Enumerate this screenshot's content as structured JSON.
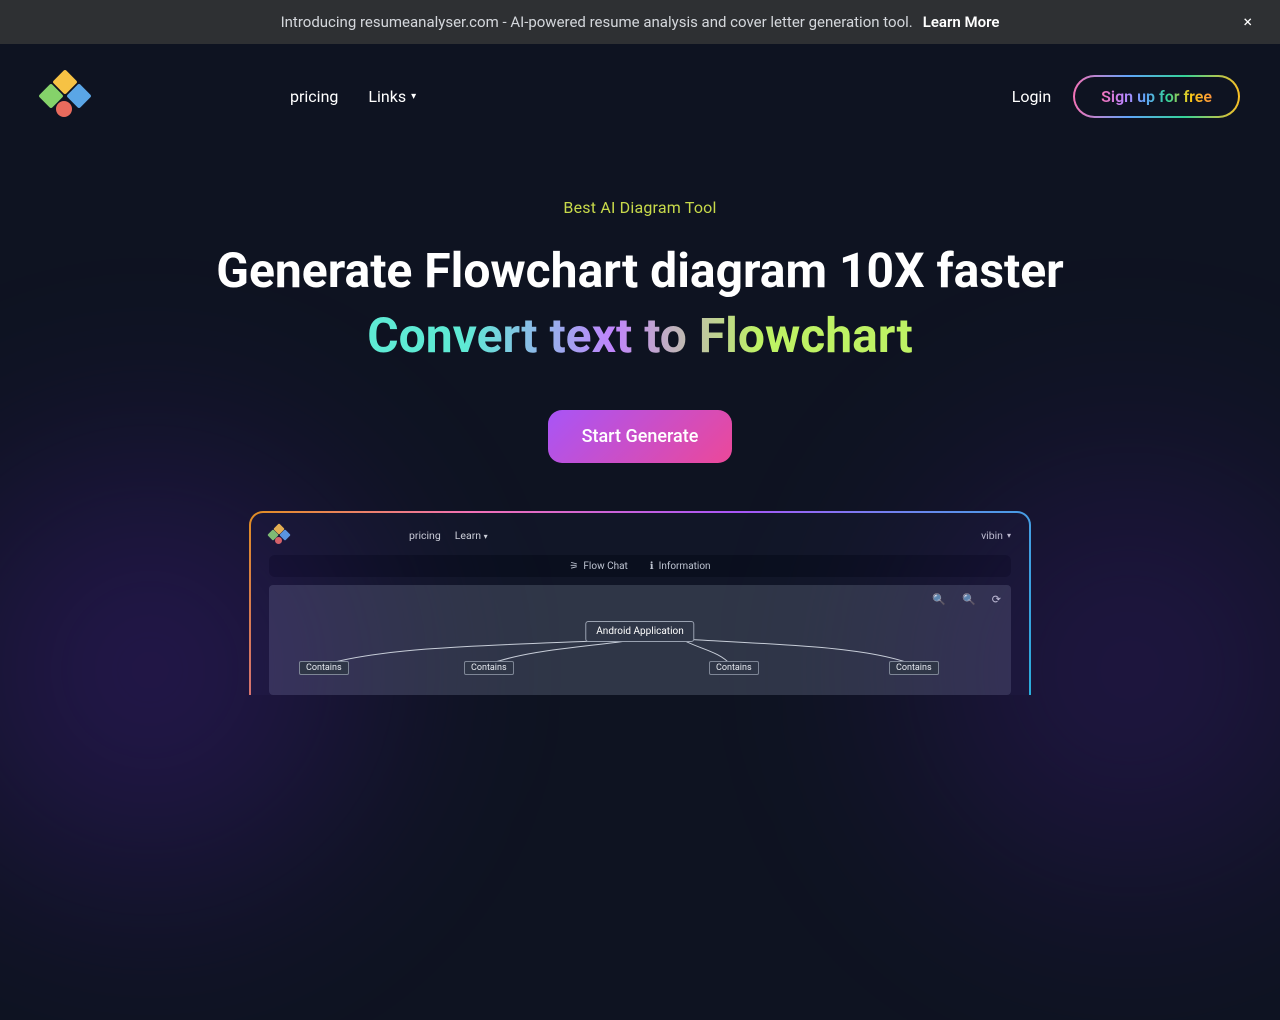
{
  "banner": {
    "text": "Introducing resumeanalyser.com - AI-powered resume analysis and cover letter generation tool.",
    "cta": "Learn More",
    "close": "×"
  },
  "nav": {
    "pricing": "pricing",
    "links": "Links"
  },
  "auth": {
    "login": "Login",
    "signup": "Sign up for free"
  },
  "hero": {
    "eyebrow": "Best AI Diagram Tool",
    "headline": "Generate Flowchart diagram 10X faster",
    "subhead": "Convert text to Flowchart",
    "cta": "Start Generate"
  },
  "demo": {
    "nav_pricing": "pricing",
    "nav_learn": "Learn",
    "user": "vibin",
    "tab_flowchat": "Flow Chat",
    "tab_info": "Information",
    "root": "Android Application",
    "edge": "Contains",
    "zoomin": "🔍",
    "zoomout": "🔍",
    "reset": "⟳"
  }
}
